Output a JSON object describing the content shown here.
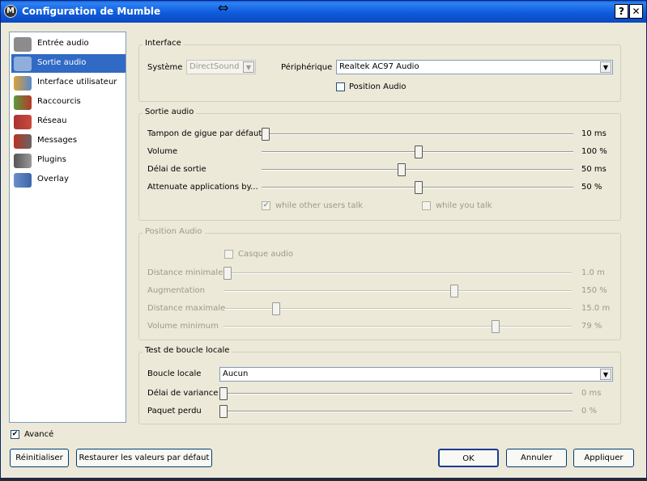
{
  "window": {
    "title": "Configuration de Mumble",
    "help_label": "?",
    "close_label": "✕"
  },
  "sidebar": {
    "items": [
      {
        "label": "Entrée audio",
        "icon": "microphone-icon"
      },
      {
        "label": "Sortie audio",
        "icon": "speaker-icon"
      },
      {
        "label": "Interface utilisateur",
        "icon": "interface-icon"
      },
      {
        "label": "Raccourcis",
        "icon": "shortcuts-icon"
      },
      {
        "label": "Réseau",
        "icon": "network-icon"
      },
      {
        "label": "Messages",
        "icon": "messages-icon"
      },
      {
        "label": "Plugins",
        "icon": "plugins-icon"
      },
      {
        "label": "Overlay",
        "icon": "overlay-icon"
      }
    ]
  },
  "interface": {
    "legend": "Interface",
    "system_label": "Système",
    "system_value": "DirectSound",
    "device_label": "Périphérique",
    "device_value": "Realtek AC97 Audio",
    "position_audio_label": "Position Audio"
  },
  "output": {
    "legend": "Sortie audio",
    "jitter_label": "Tampon de gigue par défaut",
    "jitter_value": "10 ms",
    "jitter_level": 0.0,
    "volume_label": "Volume",
    "volume_value": "100 %",
    "volume_level": 0.5,
    "delay_label": "Délai de sortie",
    "delay_value": "50 ms",
    "delay_level": 0.45,
    "attenuate_label": "Attenuate applications by...",
    "attenuate_value": "50 %",
    "attenuate_level": 0.5,
    "while_others_label": "while other users talk",
    "while_you_label": "while you talk"
  },
  "position": {
    "legend": "Position Audio",
    "headphones_label": "Casque audio",
    "min_distance_label": "Distance minimale",
    "min_distance_value": "1.0 m",
    "min_distance_level": 0.0,
    "bloom_label": "Augmentation",
    "bloom_value": "150 %",
    "bloom_level": 0.66,
    "max_distance_label": "Distance maximale",
    "max_distance_value": "15.0 m",
    "max_distance_level": 0.15,
    "min_volume_label": "Volume minimum",
    "min_volume_value": "79 %",
    "min_volume_level": 0.79
  },
  "loopback": {
    "legend": "Test de boucle locale",
    "mode_label": "Boucle locale",
    "mode_value": "Aucun",
    "variance_label": "Délai de variance",
    "variance_value": "0 ms",
    "variance_level": 0.0,
    "loss_label": "Paquet perdu",
    "loss_value": "0 %",
    "loss_level": 0.0
  },
  "footer": {
    "advanced_label": "Avancé",
    "reset_label": "Réinitialiser",
    "defaults_label": "Restaurer les valeurs par défaut",
    "ok_label": "OK",
    "cancel_label": "Annuler",
    "apply_label": "Appliquer"
  }
}
